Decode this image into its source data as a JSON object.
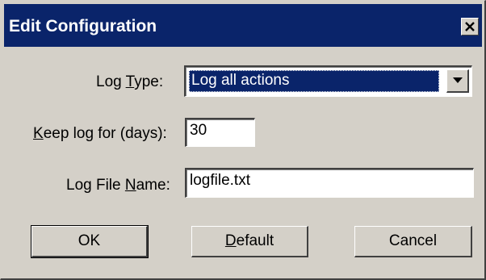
{
  "window": {
    "title": "Edit Configuration",
    "close_icon": "close-icon"
  },
  "colors": {
    "title_bar": "#0a246a",
    "face": "#d4d0c8",
    "selection": "#0a246a"
  },
  "form": {
    "log_type": {
      "label_pre": "Log ",
      "label_mnemonic": "T",
      "label_post": "ype:",
      "value": "Log all actions",
      "dropdown_icon": "chevron-down-icon"
    },
    "keep_log": {
      "label_mnemonic": "K",
      "label_post": "eep log for (days):",
      "value": "30"
    },
    "log_file": {
      "label_pre": "Log File ",
      "label_mnemonic": "N",
      "label_post": "ame:",
      "value": "logfile.txt"
    }
  },
  "buttons": {
    "ok": "OK",
    "default_mnemonic": "D",
    "default_rest": "efault",
    "cancel": "Cancel"
  }
}
